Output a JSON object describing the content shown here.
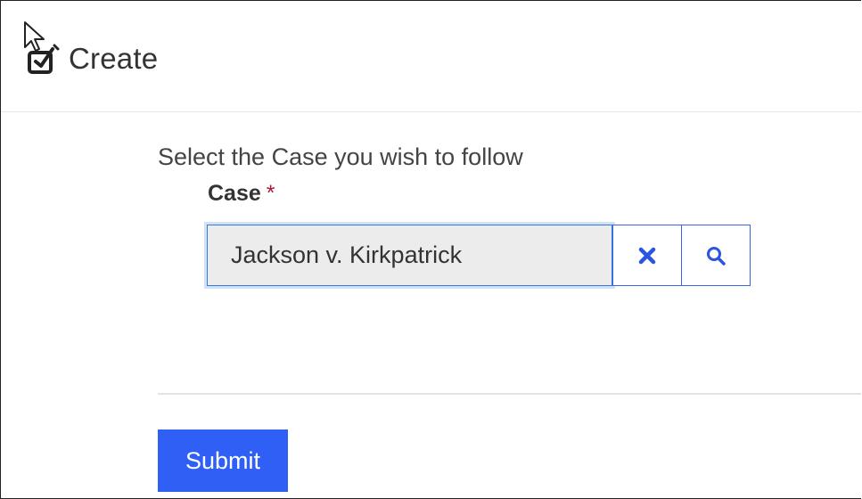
{
  "header": {
    "title": "Create",
    "icon": "create-edit-icon"
  },
  "form": {
    "prompt": "Select the Case you wish to follow",
    "case_field": {
      "label": "Case",
      "required_marker": "*",
      "value": "Jackson v. Kirkpatrick",
      "clear_icon": "close-icon",
      "search_icon": "search-icon"
    },
    "submit_label": "Submit"
  },
  "colors": {
    "accent": "#2f5ff5",
    "required": "#b1193b",
    "field_bg": "#ececec"
  }
}
